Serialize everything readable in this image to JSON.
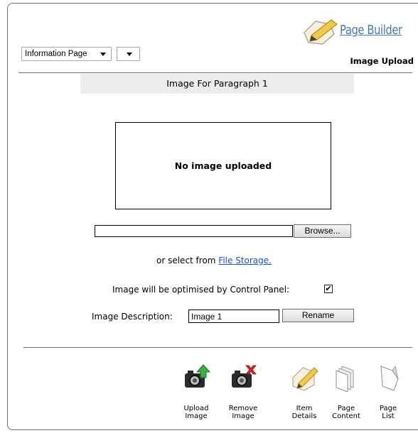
{
  "header": {
    "logo_text": "Page Builder",
    "subtitle": "Image Upload",
    "page_type_select": "Information Page",
    "secondary_select": ""
  },
  "image_section": {
    "heading": "Image For Paragraph 1",
    "placeholder": "No image uploaded"
  },
  "upload": {
    "file_value": "",
    "browse_label": "Browse...",
    "select_prefix": "or select from ",
    "file_storage_link": "File Storage."
  },
  "optimise": {
    "label": "Image will be optimised by Control Panel:",
    "checked": true
  },
  "description": {
    "label": "Image Description:",
    "value": "Image 1",
    "rename_label": "Rename"
  },
  "toolbar": {
    "upload_image": "Upload\nImage",
    "remove_image": "Remove\nImage",
    "item_details": "Item\nDetails",
    "page_content": "Page\nContent",
    "page_list": "Page\nList"
  }
}
